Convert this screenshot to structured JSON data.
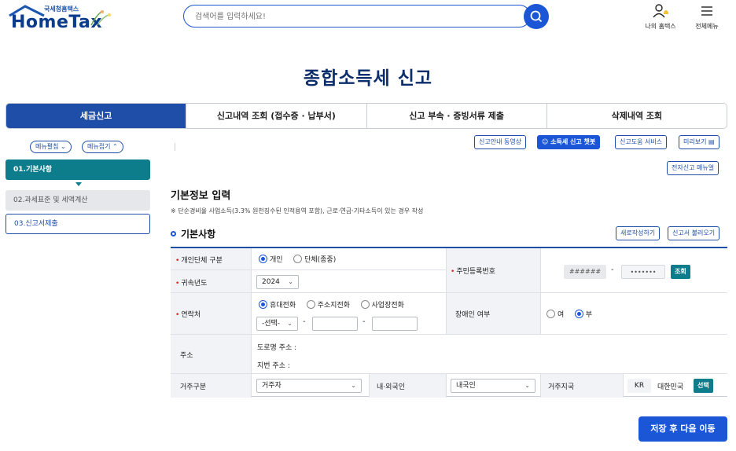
{
  "header": {
    "logo_sub": "국세청홈택스",
    "logo_main": "HomeTax",
    "search_placeholder": "검색어를 입력하세요!",
    "my_hometax": "나의 홈택스",
    "all_menu": "전체메뉴"
  },
  "page_title": "종합소득세 신고",
  "tabs": [
    {
      "label": "세금신고"
    },
    {
      "label": "신고내역 조회 (접수증 · 납부서)"
    },
    {
      "label": "신고 부속 · 증빙서류 제출"
    },
    {
      "label": "삭제내역 조회"
    }
  ],
  "left": {
    "expand": "메뉴펼침",
    "collapse": "메뉴접기",
    "steps": [
      "01.기본사항",
      "02.과세표준 및 세액계산",
      "03.신고서제출"
    ]
  },
  "toolbar": {
    "video": "신고안내 동영상",
    "chatbot": "소득세 신고 챗봇",
    "help": "신고도움 서비스",
    "preview": "미리보기",
    "manual": "전자신고 매뉴얼"
  },
  "section": {
    "title": "기본정보 입력",
    "note": "※ 단순경비율 사업소득(3.3% 원천징수된 인적용역 포함), 근로·연금·기타소득이 있는 경우 작성",
    "subtitle": "기본사항",
    "new_write": "새로작성하기",
    "load": "신고서 불러오기"
  },
  "form": {
    "type_label": "개인단체 구분",
    "type_individual": "개인",
    "type_group": "단체(종중)",
    "year_label": "귀속년도",
    "year_value": "2024",
    "rrn_label": "주민등록번호",
    "rrn_front": "######",
    "rrn_back": "•••••••",
    "lookup": "조회",
    "contact_label": "연락처",
    "contact_mobile": "휴대전화",
    "contact_home": "주소지전화",
    "contact_work": "사업장전화",
    "contact_select": "-선택-",
    "disabled_label": "장애인 여부",
    "disabled_yes": "여",
    "disabled_no": "부",
    "address_label": "주소",
    "road_address": "도로명 주소 :",
    "lot_address": "지번 주소 :",
    "residence_label": "거주구분",
    "residence_value": "거주자",
    "nationality_label": "내·외국인",
    "nationality_value": "내국인",
    "country_label": "거주지국",
    "country_code": "KR",
    "country_name": "대한민국",
    "select_btn": "선택"
  },
  "save_next": "저장 후 다음 이동"
}
